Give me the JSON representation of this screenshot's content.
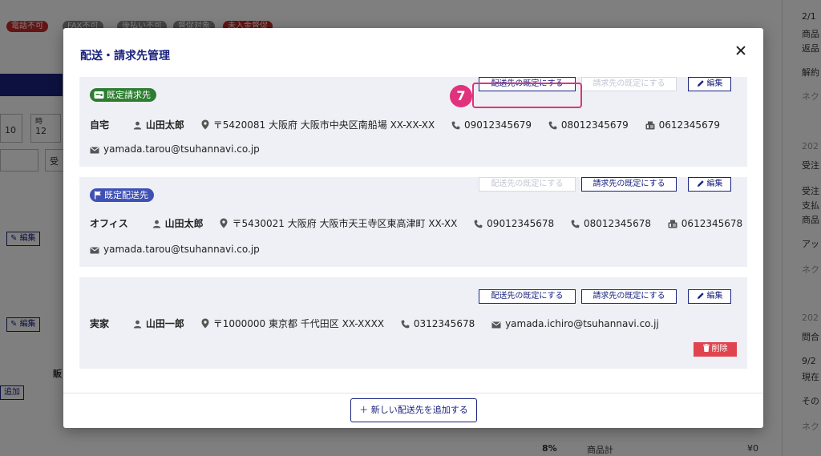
{
  "background": {
    "tags": [
      {
        "label": "電話不可",
        "color": "#c62828"
      },
      {
        "label": "FAX不可",
        "color": "#888888"
      },
      {
        "label": "後払い不可",
        "color": "#888888"
      },
      {
        "label": "督促対象",
        "color": "#888888"
      },
      {
        "label": "未入金督促",
        "color": "#c62828"
      }
    ],
    "time_label": "時",
    "day_value": "10",
    "hour_value": "12",
    "edit_label": "編集",
    "add_label": "追加",
    "sales_label": "販",
    "reception_label": "受",
    "tax_label": "8%",
    "subtotal_label": "商品計",
    "subtotal_value": "¥0",
    "right_texts": [
      "2/1",
      "商品",
      "返品",
      "解約",
      "ネク",
      "202",
      "受注",
      "受注",
      "支払",
      "商品",
      "アッ",
      "ネク",
      "202",
      "問合",
      "9/2",
      "現在",
      "その",
      "ネク"
    ]
  },
  "modal": {
    "title": "配送・請求先管理",
    "set_shipping_label": "配送先の既定にする",
    "set_billing_label": "請求先の既定にする",
    "edit_label": "編集",
    "delete_label": "削除",
    "add_label": "新しい配送先を追加する",
    "step_number": "7",
    "addresses": [
      {
        "badge": "既定請求先",
        "name": "自宅",
        "person": "山田太郎",
        "address": "〒5420081 大阪府 大阪市中央区南船場 XX-XX-XX",
        "phone1": "09012345679",
        "phone2": "08012345679",
        "fax": "0612345679",
        "email": "yamada.tarou@tsuhannavi.co.jp"
      },
      {
        "badge": "既定配送先",
        "name": "オフィス",
        "person": "山田太郎",
        "address": "〒5430021 大阪府 大阪市天王寺区東高津町 XX-XX",
        "phone1": "09012345678",
        "phone2": "08012345678",
        "fax": "0612345678",
        "email": "yamada.tarou@tsuhannavi.co.jp"
      },
      {
        "name": "実家",
        "person": "山田一郎",
        "address": "〒1000000 東京都 千代田区 XX-XXXX",
        "phone1": "0312345678",
        "email": "yamada.ichiro@tsuhannavi.co.jj"
      }
    ]
  },
  "colors": {
    "primary": "#1a237e",
    "default_billing_badge": "#2e7d32",
    "default_shipping_badge": "#3f51b5",
    "delete": "#e0454f",
    "highlight": "#e0337c"
  }
}
